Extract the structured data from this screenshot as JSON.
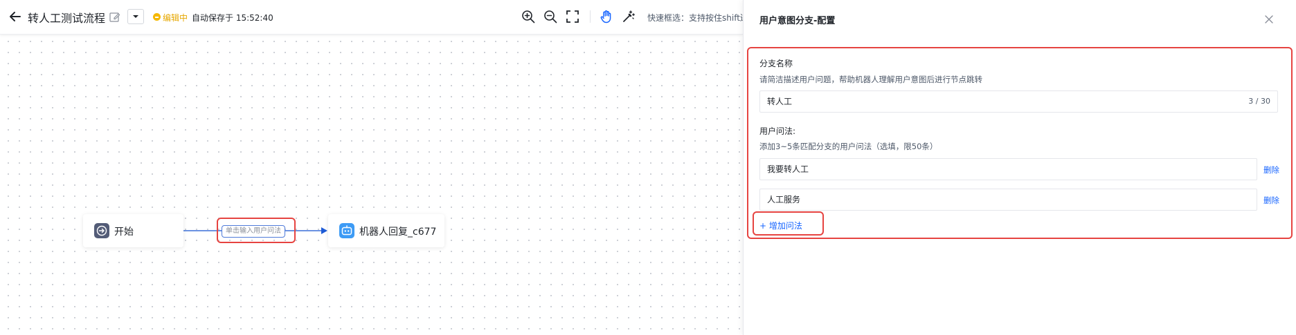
{
  "header": {
    "flow_title": "转人工测试流程",
    "status_label": "编辑中",
    "autosave_text": "自动保存于 15:52:40",
    "quick_select_hint": "快速框选：支持按住shift进行框选",
    "colors": {
      "status": "#f5b800",
      "status_text": "#e6a700"
    },
    "icons": [
      "back-arrow-icon",
      "edit-icon",
      "chevron-down-icon",
      "zoom-in-icon",
      "zoom-out-icon",
      "fullscreen-icon",
      "hand-icon",
      "magic-wand-icon"
    ]
  },
  "canvas": {
    "nodes": [
      {
        "label": "开始",
        "icon": "start-arrow-icon",
        "icon_color": "#535c77"
      },
      {
        "label": "机器人回复_c677",
        "icon": "robot-icon",
        "icon_color": "#3d9bf5"
      }
    ],
    "edge": {
      "label": "单击输入用户问法",
      "color": "#3a6fd8"
    }
  },
  "panel": {
    "title": "用户意图分支-配置",
    "branch_name": {
      "label": "分支名称",
      "hint": "请简洁描述用户问题，帮助机器人理解用户意图后进行节点跳转",
      "value": "转人工",
      "counter": "3 / 30"
    },
    "questions": {
      "label": "用户问法:",
      "hint": "添加3~5条匹配分支的用户问法（选填，限50条）",
      "items": [
        {
          "value": "我要转人工",
          "delete_label": "删除"
        },
        {
          "value": "人工服务",
          "delete_label": "删除"
        }
      ],
      "add_label": "+ 增加问法"
    },
    "colors": {
      "link": "#1664ff",
      "highlight": "#e64340"
    }
  }
}
